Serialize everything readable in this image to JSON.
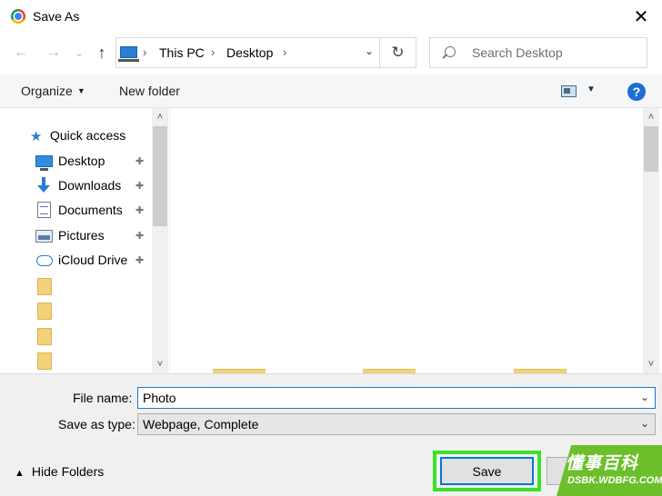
{
  "window": {
    "title": "Save As",
    "close_glyph": "✕",
    "icon": "chrome-icon"
  },
  "nav": {
    "back_glyph": "←",
    "forward_glyph": "→",
    "recent_glyph": "⌄",
    "up_glyph": "↑"
  },
  "address": {
    "crumbs": [
      "This PC",
      "Desktop"
    ],
    "separator": "›",
    "dropdown_glyph": "⌄",
    "refresh_glyph": "↻"
  },
  "search": {
    "placeholder": "Search Desktop"
  },
  "toolbar": {
    "organize_label": "Organize",
    "organize_arrow": "▼",
    "new_folder_label": "New folder",
    "view_dd_glyph": "▼",
    "help_glyph": "?"
  },
  "sidebar": {
    "quick_access_label": "Quick access",
    "items": [
      {
        "label": "Desktop",
        "icon": "desktop-icon",
        "pinned": true
      },
      {
        "label": "Downloads",
        "icon": "downloads-icon",
        "pinned": true
      },
      {
        "label": "Documents",
        "icon": "documents-icon",
        "pinned": true
      },
      {
        "label": "Pictures",
        "icon": "pictures-icon",
        "pinned": true
      },
      {
        "label": "iCloud Drive",
        "icon": "icloud-icon",
        "pinned": true
      }
    ],
    "pin_glyph": "📌",
    "scroll_up_glyph": "˄",
    "scroll_down_glyph": "˅"
  },
  "form": {
    "filename_label": "File name:",
    "filename_value": "Photo",
    "type_label": "Save as type:",
    "type_value": "Webpage, Complete",
    "dropdown_glyph": "⌄"
  },
  "footer": {
    "hide_folders_label": "Hide Folders",
    "hide_arrow": "▲",
    "save_label": "Save"
  },
  "watermark": {
    "text_cn": "懂事百科",
    "url": "DSBK.WDBFG.COM"
  },
  "colors": {
    "accent": "#0078d7",
    "highlight": "#3be22a",
    "watermark_bg": "#6cbf2b"
  }
}
